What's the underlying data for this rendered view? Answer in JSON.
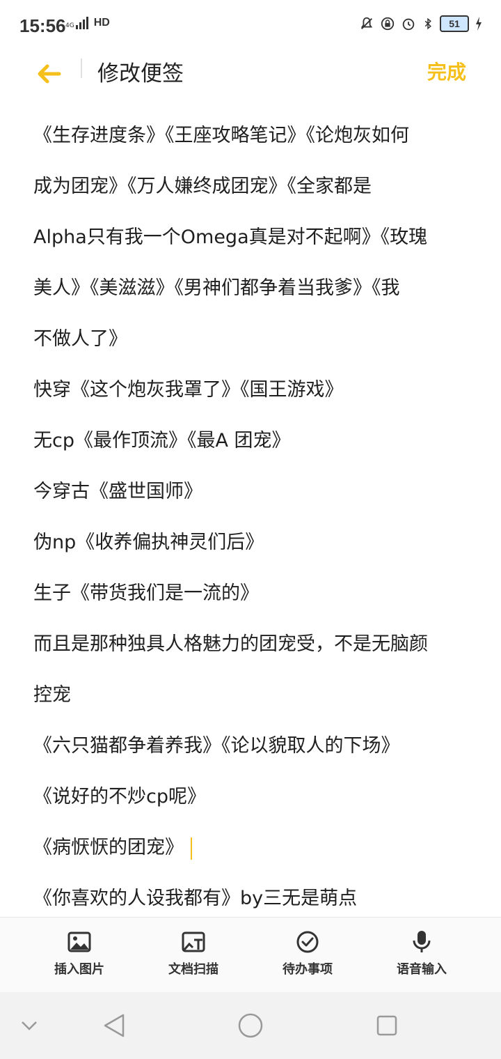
{
  "status": {
    "time": "15:56",
    "net_small": "4G",
    "net_hd": "HD",
    "battery": "51"
  },
  "appbar": {
    "title": "修改便签",
    "done_label": "完成"
  },
  "note": {
    "lines": [
      "《生存进度条》《王座攻略笔记》《论炮灰如何",
      "成为团宠》《万人嫌终成团宠》《全家都是",
      "Alpha只有我一个Omega真是对不起啊》《玫瑰",
      "美人》《美滋滋》《男神们都争着当我爹》《我",
      "不做人了》",
      "快穿《这个炮灰我罩了》《国王游戏》",
      " 无cp《最作顶流》《最A 团宠》",
      "今穿古《盛世国师》",
      "伪np《收养偏执神灵们后》",
      "生子《带货我们是一流的》",
      "而且是那种独具人格魅力的团宠受，不是无脑颜",
      "控宠",
      "《六只猫都争着养我》《论以貌取人的下场》",
      "《说好的不炒cp呢》",
      "《病恹恹的团宠》",
      "《你喜欢的人设我都有》by三无是萌点"
    ]
  },
  "toolbar": {
    "items": [
      {
        "label": "插入图片",
        "icon": "image-icon"
      },
      {
        "label": "文档扫描",
        "icon": "scan-icon"
      },
      {
        "label": "待办事项",
        "icon": "check-circle-icon"
      },
      {
        "label": "语音输入",
        "icon": "microphone-icon"
      }
    ]
  },
  "colors": {
    "accent": "#f5c01b",
    "text": "#1f1f1f"
  }
}
